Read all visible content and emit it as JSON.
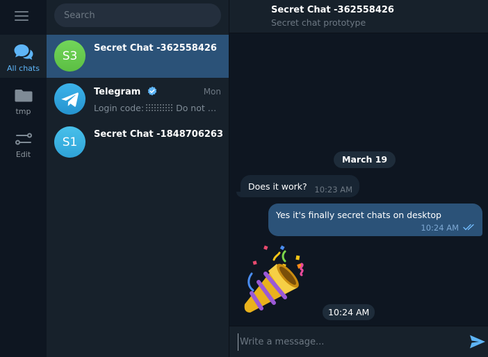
{
  "folders": [
    {
      "label": "All chats",
      "icon": "chats-icon"
    },
    {
      "label": "tmp",
      "icon": "folder-icon"
    },
    {
      "label": "Edit",
      "icon": "sliders-icon"
    }
  ],
  "search": {
    "placeholder": "Search"
  },
  "chats": [
    {
      "avatar": "S3",
      "name": "Secret Chat -362558426",
      "time": "",
      "preview": "",
      "avatar_color": "#6fc650"
    },
    {
      "avatar": "",
      "name": "Telegram",
      "time": "Mon",
      "preview_prefix": "Login code:",
      "preview_suffix": "Do not gi...",
      "avatar_color": "#2ea6de"
    },
    {
      "avatar": "S1",
      "name": "Secret Chat -1848706263",
      "time": "",
      "preview": "",
      "avatar_color": "#3bb5e3"
    }
  ],
  "conversation": {
    "title": "Secret Chat -362558426",
    "subtitle": "Secret chat prototype",
    "date_separator": "March 19",
    "messages": [
      {
        "direction": "in",
        "text": "Does it work?",
        "time": "10:23 AM"
      },
      {
        "direction": "out",
        "text": "Yes it's finally secret chats on desktop",
        "time": "10:24 AM",
        "status": "read"
      },
      {
        "direction": "in",
        "type": "sticker",
        "sticker": "party-popper-icon",
        "time": "10:24 AM"
      }
    ]
  },
  "composer": {
    "placeholder": "Write a message..."
  },
  "colors": {
    "accent": "#5eb5f7",
    "selected": "#2b5278",
    "panel": "#17212b",
    "background": "#0e1621"
  }
}
